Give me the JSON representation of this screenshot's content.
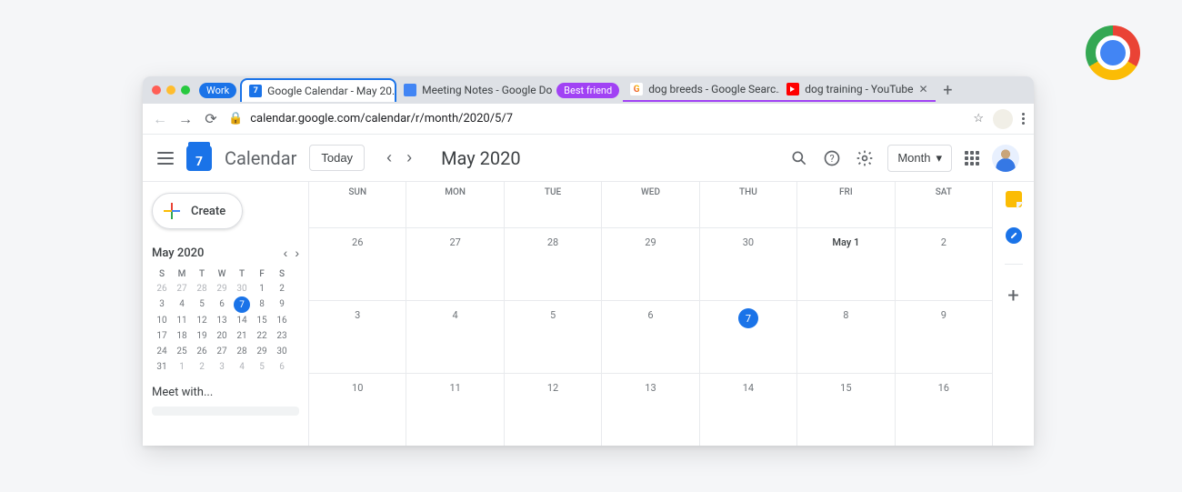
{
  "chrome": {
    "group1": "Work",
    "group2": "Best friend",
    "tabs": [
      {
        "title": "Google Calendar - May 20…",
        "favicon": "cal",
        "active": true
      },
      {
        "title": "Meeting Notes - Google Do…",
        "favicon": "doc"
      },
      {
        "title": "dog breeds - Google Searc…",
        "favicon": "google"
      },
      {
        "title": "dog training - YouTube",
        "favicon": "youtube"
      }
    ],
    "url": "calendar.google.com/calendar/r/month/2020/5/7"
  },
  "header": {
    "logo_day": "7",
    "app_name": "Calendar",
    "today": "Today",
    "month_title": "May 2020",
    "view": "Month"
  },
  "sidebar": {
    "create": "Create",
    "mini_title": "May 2020",
    "mini_dow": [
      "S",
      "M",
      "T",
      "W",
      "T",
      "F",
      "S"
    ],
    "mini_days": [
      {
        "n": "26",
        "mute": true
      },
      {
        "n": "27",
        "mute": true
      },
      {
        "n": "28",
        "mute": true
      },
      {
        "n": "29",
        "mute": true
      },
      {
        "n": "30",
        "mute": true
      },
      {
        "n": "1"
      },
      {
        "n": "2"
      },
      {
        "n": "3"
      },
      {
        "n": "4"
      },
      {
        "n": "5"
      },
      {
        "n": "6"
      },
      {
        "n": "7",
        "sel": true
      },
      {
        "n": "8"
      },
      {
        "n": "9"
      },
      {
        "n": "10"
      },
      {
        "n": "11"
      },
      {
        "n": "12"
      },
      {
        "n": "13"
      },
      {
        "n": "14"
      },
      {
        "n": "15"
      },
      {
        "n": "16"
      },
      {
        "n": "17"
      },
      {
        "n": "18"
      },
      {
        "n": "19"
      },
      {
        "n": "20"
      },
      {
        "n": "21"
      },
      {
        "n": "22"
      },
      {
        "n": "23"
      },
      {
        "n": "24"
      },
      {
        "n": "25"
      },
      {
        "n": "26"
      },
      {
        "n": "27"
      },
      {
        "n": "28"
      },
      {
        "n": "29"
      },
      {
        "n": "30"
      },
      {
        "n": "31"
      },
      {
        "n": "1",
        "mute": true
      },
      {
        "n": "2",
        "mute": true
      },
      {
        "n": "3",
        "mute": true
      },
      {
        "n": "4",
        "mute": true
      },
      {
        "n": "5",
        "mute": true
      },
      {
        "n": "6",
        "mute": true
      }
    ],
    "meet_with": "Meet with..."
  },
  "grid": {
    "dow": [
      "SUN",
      "MON",
      "TUE",
      "WED",
      "THU",
      "FRI",
      "SAT"
    ],
    "rows": [
      [
        {
          "n": "26"
        },
        {
          "n": "27"
        },
        {
          "n": "28"
        },
        {
          "n": "29"
        },
        {
          "n": "30"
        },
        {
          "n": "May 1",
          "strong": true
        },
        {
          "n": "2"
        }
      ],
      [
        {
          "n": "3"
        },
        {
          "n": "4"
        },
        {
          "n": "5"
        },
        {
          "n": "6"
        },
        {
          "n": "7",
          "today": true
        },
        {
          "n": "8"
        },
        {
          "n": "9"
        }
      ],
      [
        {
          "n": "10"
        },
        {
          "n": "11"
        },
        {
          "n": "12"
        },
        {
          "n": "13"
        },
        {
          "n": "14"
        },
        {
          "n": "15"
        },
        {
          "n": "16"
        }
      ]
    ]
  }
}
